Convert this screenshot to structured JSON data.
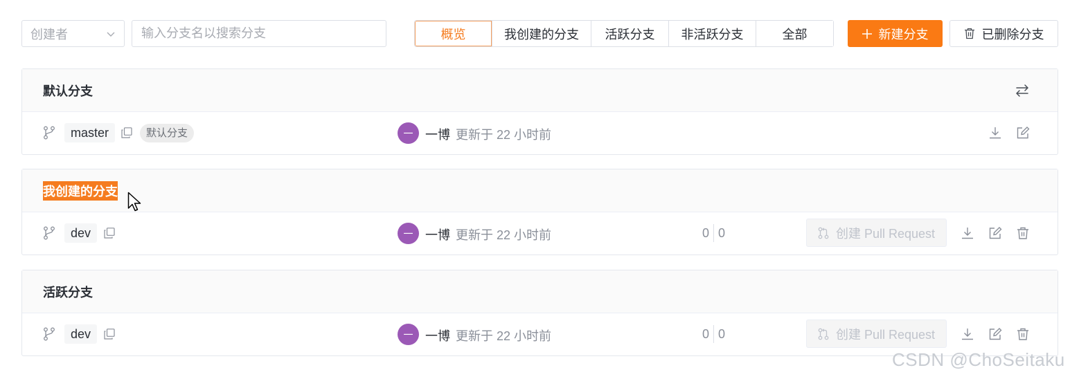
{
  "toolbar": {
    "creator_placeholder": "创建者",
    "search_placeholder": "输入分支名以搜索分支",
    "tabs": [
      {
        "label": "概览",
        "active": true
      },
      {
        "label": "我创建的分支",
        "active": false
      },
      {
        "label": "活跃分支",
        "active": false
      },
      {
        "label": "非活跃分支",
        "active": false
      },
      {
        "label": "全部",
        "active": false
      }
    ],
    "new_branch_label": "新建分支",
    "deleted_branches_label": "已删除分支"
  },
  "sections": {
    "default": {
      "title": "默认分支",
      "row": {
        "branch": "master",
        "tag": "默认分支",
        "avatar_text": "一",
        "author": "一博",
        "updated": "更新于 22 小时前"
      }
    },
    "mine": {
      "title": "我创建的分支",
      "row": {
        "branch": "dev",
        "avatar_text": "一",
        "author": "一博",
        "updated": "更新于 22 小时前",
        "behind": "0",
        "ahead": "0",
        "pr_label": "创建 Pull Request"
      }
    },
    "active": {
      "title": "活跃分支",
      "row": {
        "branch": "dev",
        "avatar_text": "一",
        "author": "一博",
        "updated": "更新于 22 小时前",
        "behind": "0",
        "ahead": "0",
        "pr_label": "创建 Pull Request"
      }
    }
  },
  "colors": {
    "accent": "#fa7a14",
    "avatar": "#9b59b6",
    "selection": "#f57c1f"
  },
  "icons": [
    "chevron-down-icon",
    "plus-icon",
    "trash-icon",
    "swap-icon",
    "branch-icon",
    "copy-icon",
    "download-icon",
    "edit-icon",
    "pull-request-icon",
    "mouse-cursor-icon"
  ],
  "watermark": "CSDN @ChoSeitaku"
}
